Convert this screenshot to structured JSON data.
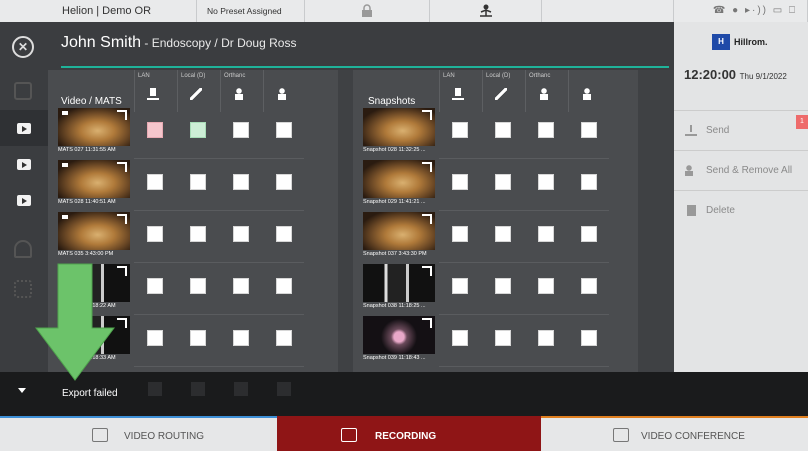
{
  "topbar": {
    "title": "Helion | Demo OR",
    "preset": "No Preset Assigned",
    "lock_icon": "lock-icon",
    "person_icon": "person-icon",
    "status_icons": "☎ ● ▸·)) ▭ ⎕"
  },
  "header": {
    "patient": "John Smith",
    "procedure": " - Endoscopy / Dr Doug Ross"
  },
  "video": {
    "title": "Video / MATS",
    "columns": [
      "LAN",
      "Local (D)",
      "Orthanc",
      ""
    ],
    "rows": [
      {
        "caption": "MATS 027 11:31:55 AM",
        "kind": "endo",
        "checks": [
          "pink",
          "green",
          "white",
          "white"
        ]
      },
      {
        "caption": "MATS 028 11:40:51 AM",
        "kind": "endo",
        "checks": [
          "white",
          "white",
          "white",
          "white"
        ]
      },
      {
        "caption": "MATS 035 3:43:00 PM",
        "kind": "endo",
        "checks": [
          "white",
          "white",
          "white",
          "white"
        ]
      },
      {
        "caption": "MATS 036 11:18:22 AM",
        "kind": "xray",
        "checks": [
          "white",
          "white",
          "white",
          "white"
        ]
      },
      {
        "caption": "MATS 037 11:18:33 AM",
        "kind": "xray",
        "checks": [
          "white",
          "white",
          "white",
          "white"
        ]
      }
    ]
  },
  "snapshots": {
    "title": "Snapshots",
    "columns": [
      "LAN",
      "Local (D)",
      "Orthanc",
      ""
    ],
    "rows": [
      {
        "caption": "Snapshot 028 11:32:25 ...",
        "kind": "endo"
      },
      {
        "caption": "Snapshot 029 11:41:21 ...",
        "kind": "endo"
      },
      {
        "caption": "Snapshot 037 3:43:30 PM",
        "kind": "endo"
      },
      {
        "caption": "Snapshot 038 11:18:25 ...",
        "kind": "xray"
      },
      {
        "caption": "Snapshot 039 11:18:43 ...",
        "kind": "dark"
      }
    ]
  },
  "sidebar": {
    "brand": "Hillrom.",
    "brand_mark": "H",
    "time": "12:20:00",
    "date": "Thu 9/1/2022",
    "badge": "1",
    "actions": [
      "Send",
      "Send & Remove All",
      "Delete"
    ]
  },
  "export": {
    "message": "Export failed"
  },
  "bottomnav": {
    "routing": "VIDEO ROUTING",
    "recording": "RECORDING",
    "conference": "VIDEO CONFERENCE"
  },
  "colors": {
    "accent_teal": "#1fb39a",
    "recording_red": "#8f1516",
    "arrow_green": "#6cc36a",
    "routing_blue": "#3d8fd6",
    "conference_orange": "#e07f1f"
  }
}
